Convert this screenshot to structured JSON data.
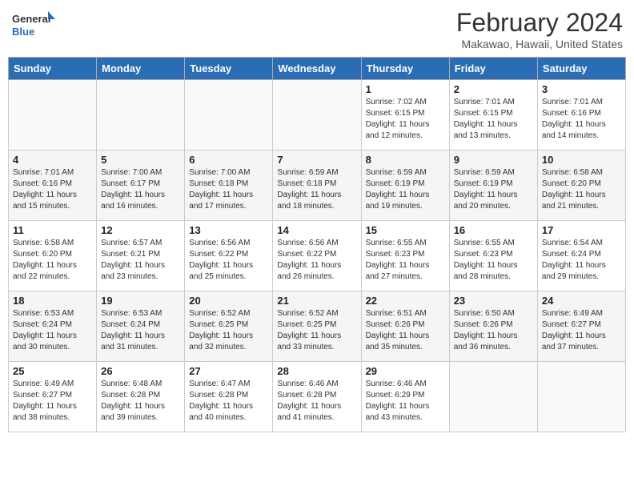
{
  "header": {
    "logo_general": "General",
    "logo_blue": "Blue",
    "month_year": "February 2024",
    "location": "Makawao, Hawaii, United States"
  },
  "days_of_week": [
    "Sunday",
    "Monday",
    "Tuesday",
    "Wednesday",
    "Thursday",
    "Friday",
    "Saturday"
  ],
  "weeks": [
    [
      {
        "day": "",
        "sunrise": "",
        "sunset": "",
        "daylight": ""
      },
      {
        "day": "",
        "sunrise": "",
        "sunset": "",
        "daylight": ""
      },
      {
        "day": "",
        "sunrise": "",
        "sunset": "",
        "daylight": ""
      },
      {
        "day": "",
        "sunrise": "",
        "sunset": "",
        "daylight": ""
      },
      {
        "day": "1",
        "sunrise": "7:02 AM",
        "sunset": "6:15 PM",
        "daylight": "11 hours and 12 minutes."
      },
      {
        "day": "2",
        "sunrise": "7:01 AM",
        "sunset": "6:15 PM",
        "daylight": "11 hours and 13 minutes."
      },
      {
        "day": "3",
        "sunrise": "7:01 AM",
        "sunset": "6:16 PM",
        "daylight": "11 hours and 14 minutes."
      }
    ],
    [
      {
        "day": "4",
        "sunrise": "7:01 AM",
        "sunset": "6:16 PM",
        "daylight": "11 hours and 15 minutes."
      },
      {
        "day": "5",
        "sunrise": "7:00 AM",
        "sunset": "6:17 PM",
        "daylight": "11 hours and 16 minutes."
      },
      {
        "day": "6",
        "sunrise": "7:00 AM",
        "sunset": "6:18 PM",
        "daylight": "11 hours and 17 minutes."
      },
      {
        "day": "7",
        "sunrise": "6:59 AM",
        "sunset": "6:18 PM",
        "daylight": "11 hours and 18 minutes."
      },
      {
        "day": "8",
        "sunrise": "6:59 AM",
        "sunset": "6:19 PM",
        "daylight": "11 hours and 19 minutes."
      },
      {
        "day": "9",
        "sunrise": "6:59 AM",
        "sunset": "6:19 PM",
        "daylight": "11 hours and 20 minutes."
      },
      {
        "day": "10",
        "sunrise": "6:58 AM",
        "sunset": "6:20 PM",
        "daylight": "11 hours and 21 minutes."
      }
    ],
    [
      {
        "day": "11",
        "sunrise": "6:58 AM",
        "sunset": "6:20 PM",
        "daylight": "11 hours and 22 minutes."
      },
      {
        "day": "12",
        "sunrise": "6:57 AM",
        "sunset": "6:21 PM",
        "daylight": "11 hours and 23 minutes."
      },
      {
        "day": "13",
        "sunrise": "6:56 AM",
        "sunset": "6:22 PM",
        "daylight": "11 hours and 25 minutes."
      },
      {
        "day": "14",
        "sunrise": "6:56 AM",
        "sunset": "6:22 PM",
        "daylight": "11 hours and 26 minutes."
      },
      {
        "day": "15",
        "sunrise": "6:55 AM",
        "sunset": "6:23 PM",
        "daylight": "11 hours and 27 minutes."
      },
      {
        "day": "16",
        "sunrise": "6:55 AM",
        "sunset": "6:23 PM",
        "daylight": "11 hours and 28 minutes."
      },
      {
        "day": "17",
        "sunrise": "6:54 AM",
        "sunset": "6:24 PM",
        "daylight": "11 hours and 29 minutes."
      }
    ],
    [
      {
        "day": "18",
        "sunrise": "6:53 AM",
        "sunset": "6:24 PM",
        "daylight": "11 hours and 30 minutes."
      },
      {
        "day": "19",
        "sunrise": "6:53 AM",
        "sunset": "6:24 PM",
        "daylight": "11 hours and 31 minutes."
      },
      {
        "day": "20",
        "sunrise": "6:52 AM",
        "sunset": "6:25 PM",
        "daylight": "11 hours and 32 minutes."
      },
      {
        "day": "21",
        "sunrise": "6:52 AM",
        "sunset": "6:25 PM",
        "daylight": "11 hours and 33 minutes."
      },
      {
        "day": "22",
        "sunrise": "6:51 AM",
        "sunset": "6:26 PM",
        "daylight": "11 hours and 35 minutes."
      },
      {
        "day": "23",
        "sunrise": "6:50 AM",
        "sunset": "6:26 PM",
        "daylight": "11 hours and 36 minutes."
      },
      {
        "day": "24",
        "sunrise": "6:49 AM",
        "sunset": "6:27 PM",
        "daylight": "11 hours and 37 minutes."
      }
    ],
    [
      {
        "day": "25",
        "sunrise": "6:49 AM",
        "sunset": "6:27 PM",
        "daylight": "11 hours and 38 minutes."
      },
      {
        "day": "26",
        "sunrise": "6:48 AM",
        "sunset": "6:28 PM",
        "daylight": "11 hours and 39 minutes."
      },
      {
        "day": "27",
        "sunrise": "6:47 AM",
        "sunset": "6:28 PM",
        "daylight": "11 hours and 40 minutes."
      },
      {
        "day": "28",
        "sunrise": "6:46 AM",
        "sunset": "6:28 PM",
        "daylight": "11 hours and 41 minutes."
      },
      {
        "day": "29",
        "sunrise": "6:46 AM",
        "sunset": "6:29 PM",
        "daylight": "11 hours and 43 minutes."
      },
      {
        "day": "",
        "sunrise": "",
        "sunset": "",
        "daylight": ""
      },
      {
        "day": "",
        "sunrise": "",
        "sunset": "",
        "daylight": ""
      }
    ]
  ]
}
